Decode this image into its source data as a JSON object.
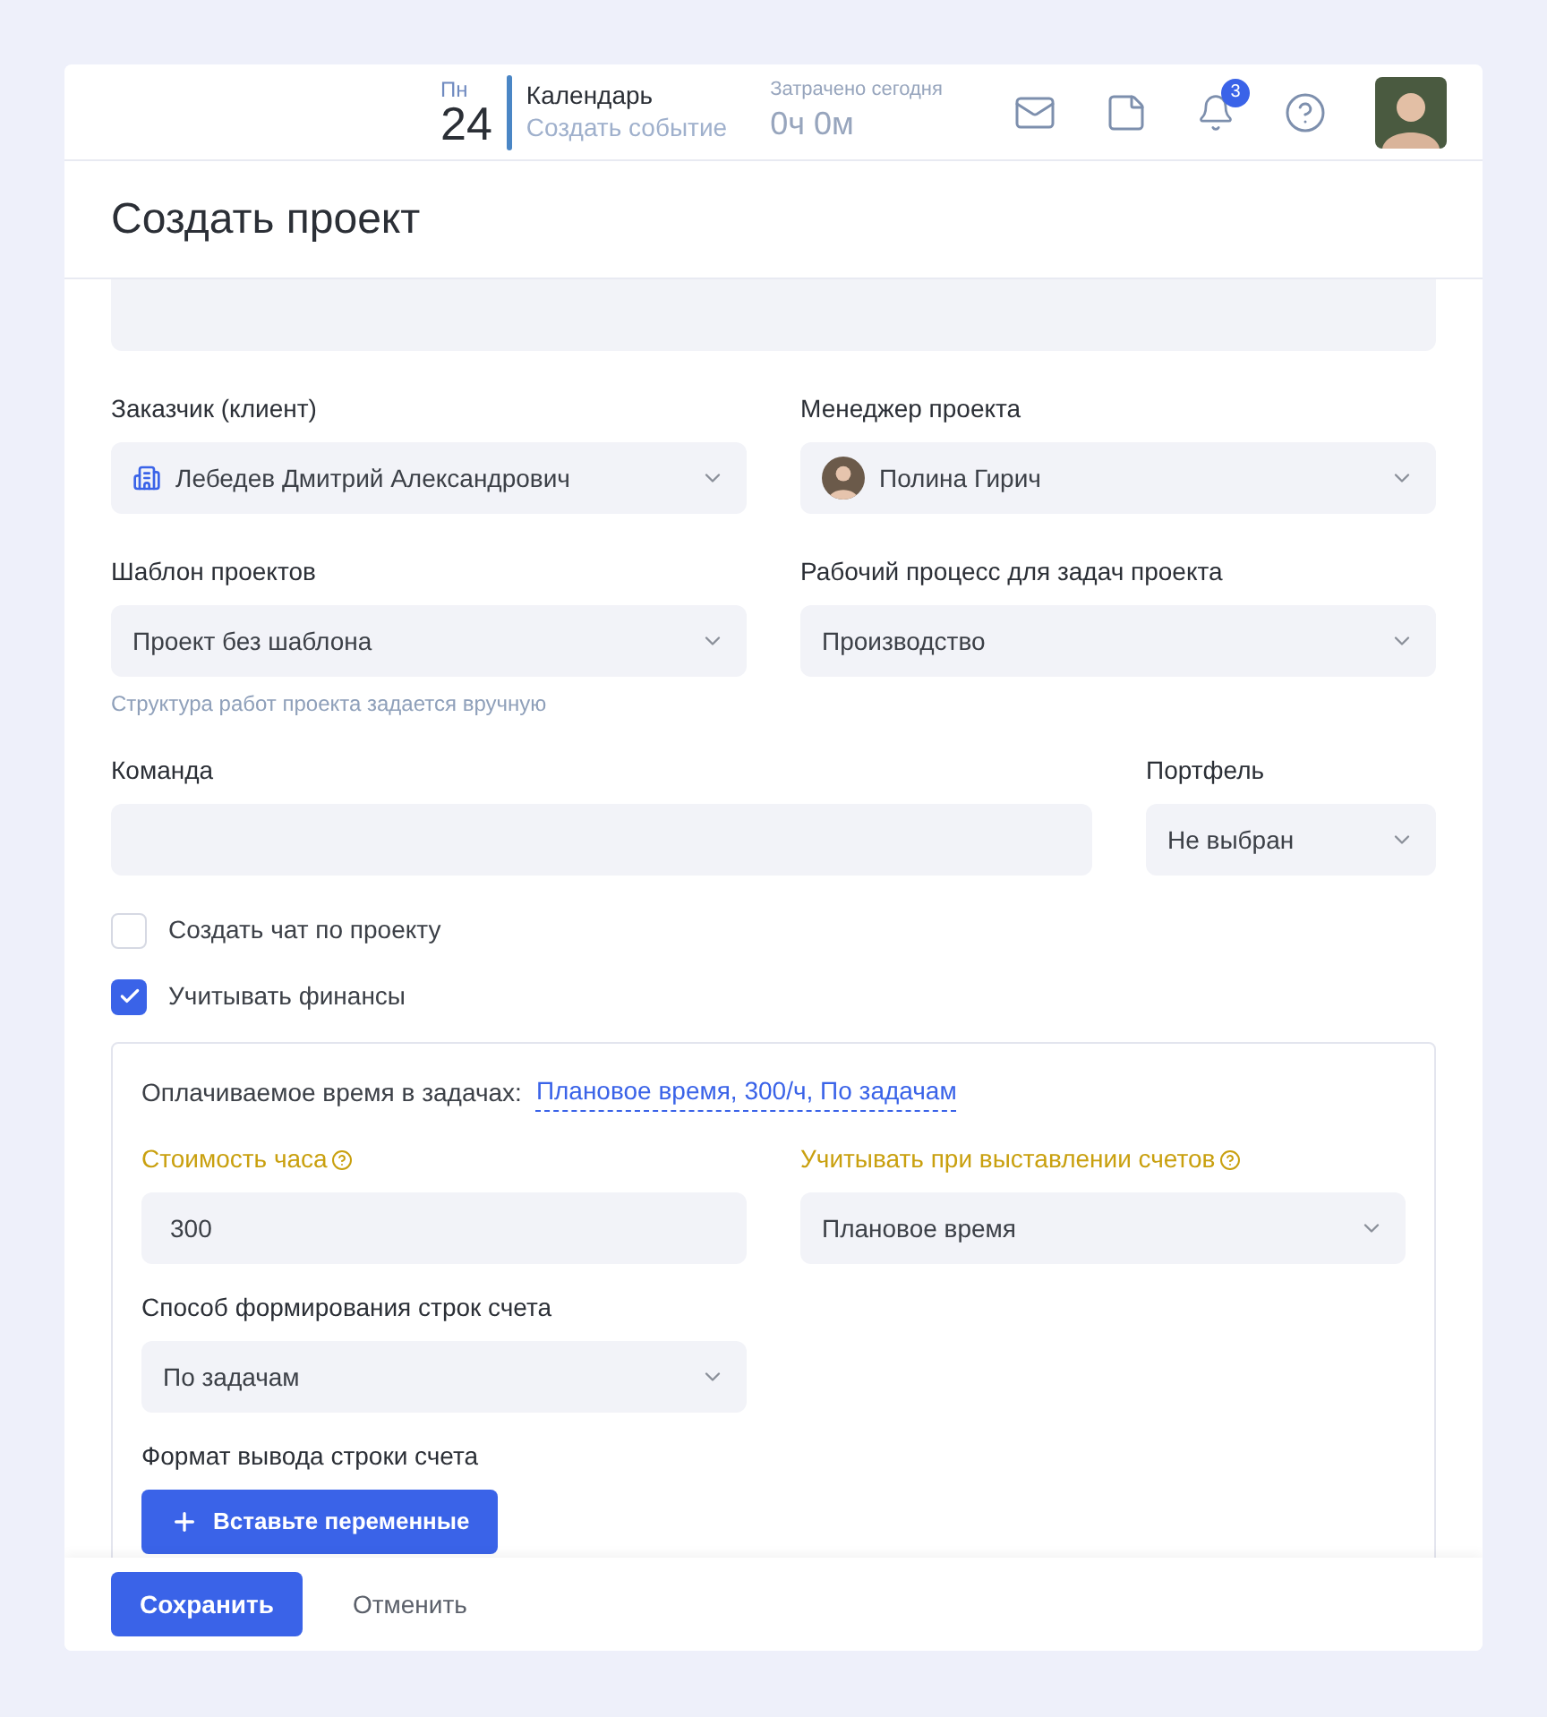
{
  "header": {
    "day_name": "Пн",
    "day_number": "24",
    "calendar_title": "Календарь",
    "create_event": "Создать событие",
    "spent_label": "Затрачено сегодня",
    "spent_value": "0ч 0м",
    "notification_count": "3"
  },
  "title": "Создать проект",
  "customer": {
    "label": "Заказчик (клиент)",
    "value": "Лебедев Дмитрий Александрович"
  },
  "manager": {
    "label": "Менеджер проекта",
    "value": "Полина Гирич"
  },
  "template": {
    "label": "Шаблон проектов",
    "value": "Проект без шаблона",
    "hint": "Структура работ проекта задается вручную"
  },
  "workflow": {
    "label": "Рабочий процесс для задач проекта",
    "value": "Производство"
  },
  "team": {
    "label": "Команда"
  },
  "portfolio": {
    "label": "Портфель",
    "value": "Не выбран"
  },
  "checkboxes": [
    {
      "label": "Создать чат по проекту",
      "checked": false
    },
    {
      "label": "Учитывать финансы",
      "checked": true
    }
  ],
  "finance": {
    "summary_label": "Оплачиваемое время в задачах:",
    "summary_link": "Плановое время, 300/ч, По задачам",
    "hour_cost": {
      "label": "Стоимость часа",
      "value": "300"
    },
    "billing": {
      "label": "Учитывать при выставлении счетов",
      "value": "Плановое время"
    },
    "line_method": {
      "label": "Способ формирования строк счета",
      "value": "По задачам"
    },
    "format": {
      "label": "Формат вывода строки счета",
      "button": "Вставьте переменные"
    }
  },
  "footer": {
    "save": "Сохранить",
    "cancel": "Отменить"
  }
}
